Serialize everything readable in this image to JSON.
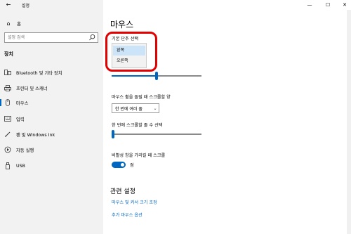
{
  "window": {
    "title": "설정",
    "back_glyph": "←",
    "minimize_glyph": "—",
    "maximize_glyph": "☐",
    "close_glyph": "✕"
  },
  "sidebar": {
    "home_label": "홈",
    "search_placeholder": "설정 검색",
    "section_title": "장치",
    "items": [
      {
        "label": "Bluetooth 및 기타 장치",
        "icon": "bluetooth-icon"
      },
      {
        "label": "프린터 및 스캐너",
        "icon": "printer-icon"
      },
      {
        "label": "마우스",
        "icon": "mouse-icon",
        "active": true
      },
      {
        "label": "입력",
        "icon": "keyboard-icon"
      },
      {
        "label": "펜 및 Windows Ink",
        "icon": "pen-icon"
      },
      {
        "label": "자동 실행",
        "icon": "autoplay-icon"
      },
      {
        "label": "USB",
        "icon": "usb-icon"
      }
    ]
  },
  "main": {
    "page_title": "마우스",
    "primary_button_label": "기본 단추 선택",
    "primary_options": [
      "왼쪽",
      "오른쪽"
    ],
    "primary_selected": "왼쪽",
    "cursor_speed_value": 0.5,
    "wheel_label": "마우스 휠을 돌릴 때 스크롤할 양",
    "wheel_value": "한 번에 여러 줄",
    "lines_label": "한 번에 스크롤할 줄 수 선택",
    "lines_value": 0.0,
    "inactive_scroll_label": "비활성 창을 가리킬 때 스크롤",
    "inactive_scroll_state": "켬",
    "related_title": "관련 설정",
    "related_links": [
      "마우스 및 커서 크기 조정",
      "추가 마우스 옵션"
    ]
  },
  "colors": {
    "accent": "#0067c0",
    "highlight": "#e20000",
    "sidebar_bg": "#f2f2f2"
  }
}
